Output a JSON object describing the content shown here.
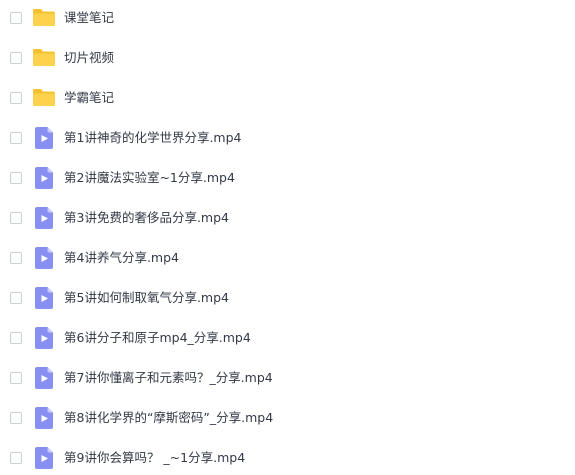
{
  "colors": {
    "folder": "#ffd24d",
    "folder_tab": "#f5c030",
    "video_bg": "#8790f0",
    "video_corner": "#c7ccfa",
    "text": "#333a46",
    "checkbox_border": "#c9ced8"
  },
  "files": [
    {
      "type": "folder",
      "icon": "folder-icon",
      "name": "课堂笔记"
    },
    {
      "type": "folder",
      "icon": "folder-icon",
      "name": "切片视频"
    },
    {
      "type": "folder",
      "icon": "folder-icon",
      "name": "学霸笔记"
    },
    {
      "type": "video",
      "icon": "video-file-icon",
      "name": "第1讲神奇的化学世界分享.mp4"
    },
    {
      "type": "video",
      "icon": "video-file-icon",
      "name": "第2讲魔法实验室~1分享.mp4"
    },
    {
      "type": "video",
      "icon": "video-file-icon",
      "name": "第3讲免费的奢侈品分享.mp4"
    },
    {
      "type": "video",
      "icon": "video-file-icon",
      "name": "第4讲养气分享.mp4"
    },
    {
      "type": "video",
      "icon": "video-file-icon",
      "name": "第5讲如何制取氧气分享.mp4"
    },
    {
      "type": "video",
      "icon": "video-file-icon",
      "name": "第6讲分子和原子mp4_分享.mp4"
    },
    {
      "type": "video",
      "icon": "video-file-icon",
      "name": "第7讲你懂离子和元素吗？_分享.mp4"
    },
    {
      "type": "video",
      "icon": "video-file-icon",
      "name": "第8讲化学界的“摩斯密码”_分享.mp4"
    },
    {
      "type": "video",
      "icon": "video-file-icon",
      "name": "第9讲你会算吗？ _~1分享.mp4"
    }
  ]
}
